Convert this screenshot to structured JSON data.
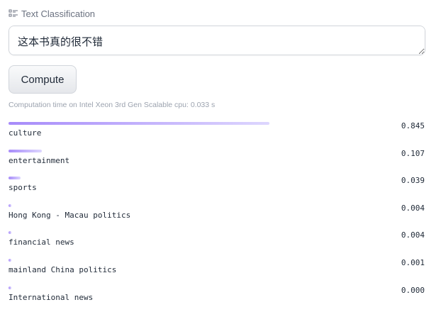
{
  "task": {
    "icon": "text-classification-icon",
    "label": "Text Classification"
  },
  "input": {
    "value": "这本书真的很不错"
  },
  "compute_button": {
    "label": "Compute"
  },
  "timing": "Computation time on Intel Xeon 3rd Gen Scalable cpu: 0.033 s",
  "colors": {
    "bar_start": "#a78bfa",
    "bar_end": "#ddd6fe"
  },
  "results": [
    {
      "label": "culture",
      "score": "0.845",
      "fraction": 0.845
    },
    {
      "label": "entertainment",
      "score": "0.107",
      "fraction": 0.107
    },
    {
      "label": "sports",
      "score": "0.039",
      "fraction": 0.039
    },
    {
      "label": "Hong Kong - Macau politics",
      "score": "0.004",
      "fraction": 0.004
    },
    {
      "label": "financial news",
      "score": "0.004",
      "fraction": 0.004
    },
    {
      "label": "mainland China politics",
      "score": "0.001",
      "fraction": 0.001
    },
    {
      "label": "International news",
      "score": "0.000",
      "fraction": 0.0
    }
  ]
}
